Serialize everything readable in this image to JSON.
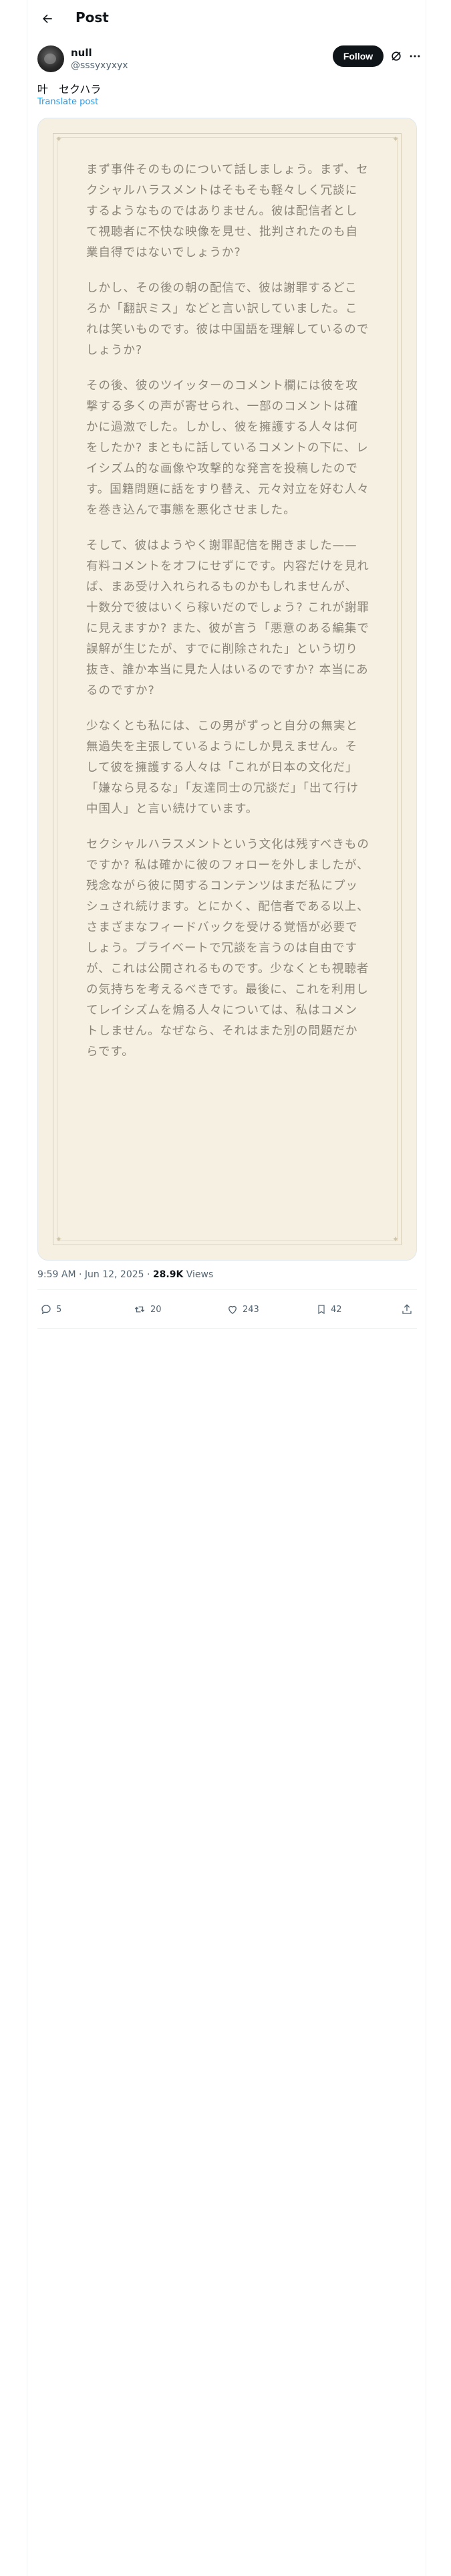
{
  "header": {
    "title": "Post"
  },
  "author": {
    "name": "null",
    "handle": "@sssyxyxyx",
    "follow_label": "Follow"
  },
  "post": {
    "text": "叶　セクハラ",
    "translate_label": "Translate post",
    "paragraphs": [
      "まず事件そのものについて話しましょう。まず、セクシャルハラスメントはそもそも軽々しく冗談にするようなものではありません。彼は配信者として視聴者に不快な映像を見せ、批判されたのも自業自得ではないでしょうか?",
      "しかし、その後の朝の配信で、彼は謝罪するどころか「翻訳ミス」などと言い訳していました。これは笑いものです。彼は中国語を理解しているのでしょうか?",
      "その後、彼のツイッターのコメント欄には彼を攻撃する多くの声が寄せられ、一部のコメントは確かに過激でした。しかし、彼を擁護する人々は何をしたか? まともに話しているコメントの下に、レイシズム的な画像や攻撃的な発言を投稿したのです。国籍問題に話をすり替え、元々対立を好む人々を巻き込んで事態を悪化させました。",
      "そして、彼はようやく謝罪配信を開きました——有料コメントをオフにせずにです。内容だけを見れば、まあ受け入れられるものかもしれませんが、十数分で彼はいくら稼いだのでしょう? これが謝罪に見えますか? また、彼が言う「悪意のある編集で誤解が生じたが、すでに削除された」という切り抜き、誰か本当に見た人はいるのですか? 本当にあるのですか?",
      "少なくとも私には、この男がずっと自分の無実と無過失を主張しているようにしか見えません。そして彼を擁護する人々は「これが日本の文化だ」「嫌なら見るな」「友達同士の冗談だ」「出て行け中国人」と言い続けています。",
      "セクシャルハラスメントという文化は残すべきものですか? 私は確かに彼のフォローを外しましたが、残念ながら彼に関するコンテンツはまだ私にプッシュされ続けます。とにかく、配信者である以上、さまざまなフィードバックを受ける覚悟が必要でしょう。プライベートで冗談を言うのは自由ですが、これは公開されるものです。少なくとも視聴者の気持ちを考えるべきです。最後に、これを利用してレイシズムを煽る人々については、私はコメントしません。なぜなら、それはまた別の問題だからです。"
    ]
  },
  "meta": {
    "time": "9:59 AM · Jun 12, 2025 · ",
    "views_count": "28.9K",
    "views_label": " Views"
  },
  "actions": {
    "replies": "5",
    "reposts": "20",
    "likes": "243",
    "bookmarks": "42"
  }
}
